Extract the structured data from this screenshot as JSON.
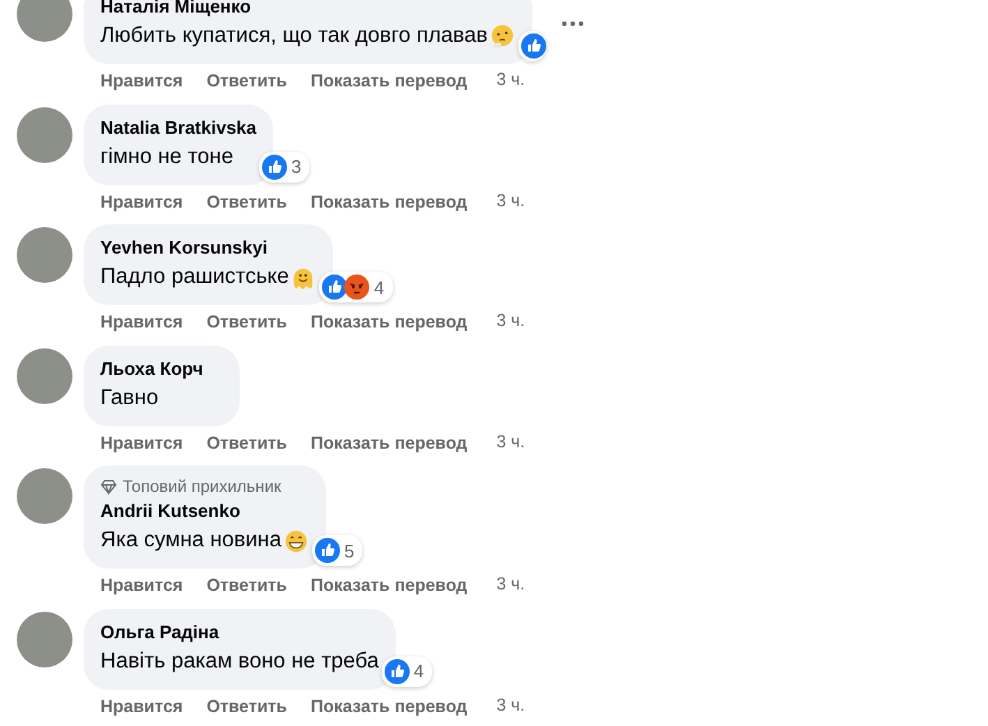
{
  "comments": [
    {
      "author": "Наталія Міщенко",
      "text": "Любить купатися, що так довго плавав",
      "emoji": {
        "kind": "thinking"
      },
      "reactions": [
        {
          "kind": "like"
        }
      ],
      "more": true,
      "actions": [
        "Нравится",
        "Ответить",
        "Показать перевод",
        "3 ч."
      ]
    },
    {
      "author": "Natalia Bratkivska",
      "text": "гімно не тоне",
      "reactions": [
        {
          "kind": "like"
        }
      ],
      "count": "3",
      "actions": [
        "Нравится",
        "Ответить",
        "Показать перевод",
        "3 ч."
      ]
    },
    {
      "author": "Yevhen Korsunskyi",
      "text": "Падло рашистське ",
      "emoji": {
        "kind": "melting"
      },
      "reactions": [
        {
          "kind": "like"
        },
        {
          "kind": "angry"
        }
      ],
      "count": "4",
      "actions": [
        "Нравится",
        "Ответить",
        "Показать перевод",
        "3 ч."
      ]
    },
    {
      "author": "Льоха Корч",
      "text": "Гавно",
      "actions": [
        "Нравится",
        "Ответить",
        "Показать перевод",
        "3 ч."
      ]
    },
    {
      "badge": "Топовий прихильник",
      "author": "Andrii Kutsenko",
      "text": "Яка сумна новина",
      "emoji": {
        "kind": "grin"
      },
      "reactions": [
        {
          "kind": "like"
        }
      ],
      "count": "5",
      "actions": [
        "Нравится",
        "Ответить",
        "Показать перевод",
        "3 ч."
      ]
    },
    {
      "author": "Ольга Радіна",
      "text": "Навіть ракам воно не треба",
      "reactions": [
        {
          "kind": "like"
        }
      ],
      "count": "4",
      "actions": [
        "Нравится",
        "Ответить",
        "Показать перевод",
        "3 ч."
      ]
    }
  ]
}
